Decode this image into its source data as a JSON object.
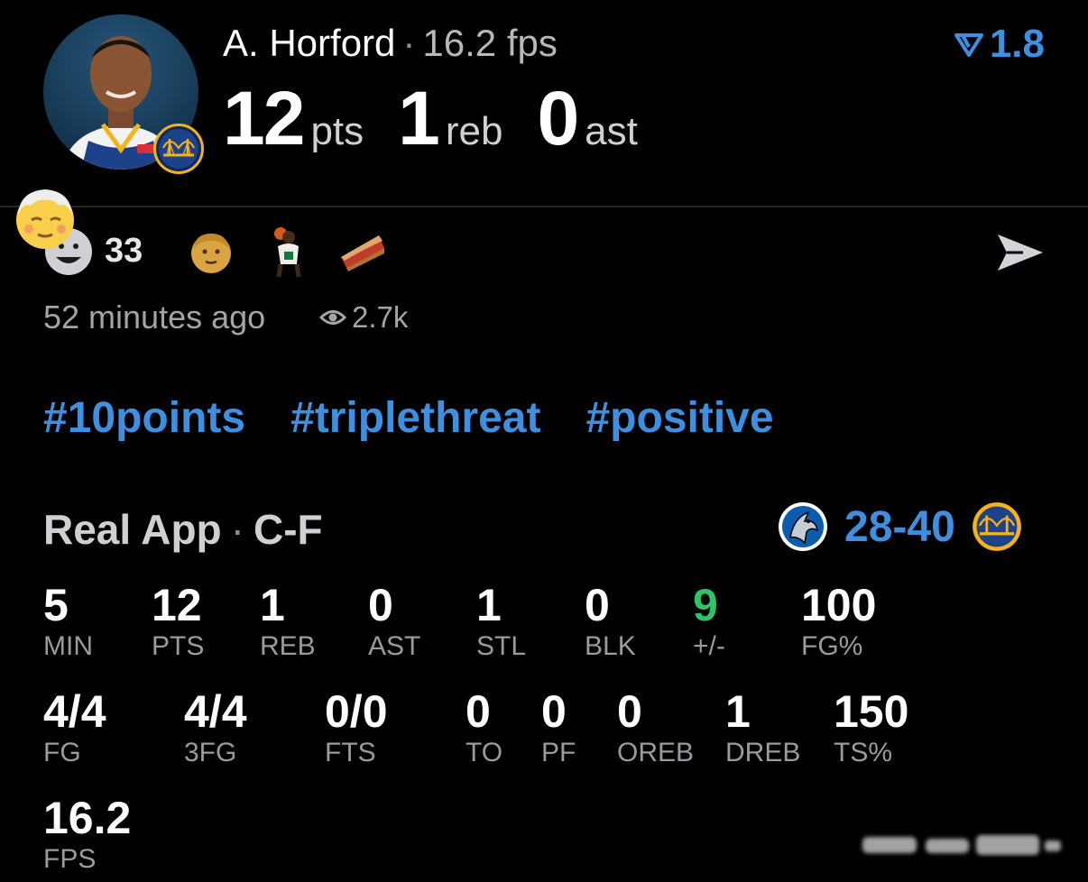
{
  "header": {
    "player_name": "A. Horford",
    "separator": "·",
    "fps_label": "16.2 fps",
    "delta_value": "1.8",
    "stats": [
      {
        "value": "12",
        "unit": "pts"
      },
      {
        "value": "1",
        "unit": "reb"
      },
      {
        "value": "0",
        "unit": "ast"
      }
    ]
  },
  "reactions": {
    "count": "33",
    "emojis": [
      "old-man-emoji",
      "player-sticker",
      "pie-emoji"
    ],
    "timestamp": "52 minutes ago",
    "views": "2.7k"
  },
  "hashtags": [
    "#10points",
    "#triplethreat",
    "#positive"
  ],
  "game": {
    "source": "Real App",
    "separator": "·",
    "position": "C-F",
    "score": "28-40"
  },
  "stats_rows": [
    [
      {
        "value": "5",
        "label": "MIN"
      },
      {
        "value": "12",
        "label": "PTS"
      },
      {
        "value": "1",
        "label": "REB"
      },
      {
        "value": "0",
        "label": "AST"
      },
      {
        "value": "1",
        "label": "STL"
      },
      {
        "value": "0",
        "label": "BLK"
      },
      {
        "value": "9",
        "label": "+/-"
      },
      {
        "value": "100",
        "label": "FG%"
      }
    ],
    [
      {
        "value": "4/4",
        "label": "FG"
      },
      {
        "value": "4/4",
        "label": "3FG"
      },
      {
        "value": "0/0",
        "label": "FTS"
      },
      {
        "value": "0",
        "label": "TO"
      },
      {
        "value": "0",
        "label": "PF"
      },
      {
        "value": "0",
        "label": "OREB"
      },
      {
        "value": "1",
        "label": "DREB"
      },
      {
        "value": "150",
        "label": "TS%"
      }
    ],
    [
      {
        "value": "16.2",
        "label": "FPS"
      }
    ]
  ],
  "colors": {
    "accent_blue": "#3f8fe0",
    "positive_green": "#2fc36a",
    "background": "#000000"
  }
}
